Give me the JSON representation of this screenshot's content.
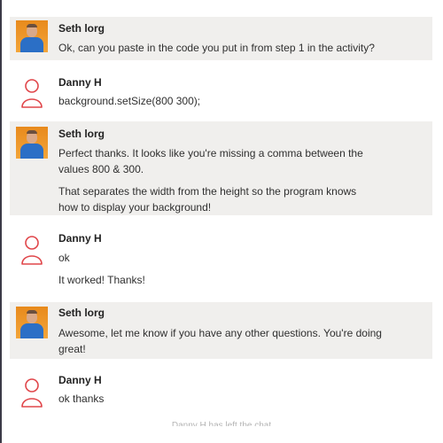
{
  "messages": [
    {
      "author": "Seth lorg",
      "avatar": "photo",
      "paragraphs": [
        "Ok, can you paste in the code you put in from step 1 in the activity?"
      ]
    },
    {
      "author": "Danny H",
      "avatar": "user-outline-icon",
      "paragraphs": [
        "background.setSize(800 300);"
      ]
    },
    {
      "author": "Seth lorg",
      "avatar": "photo",
      "paragraphs": [
        "Perfect thanks.  It looks like you're missing a comma between the values 800 & 300.",
        "That separates the width from the height so the program knows how to display your background!"
      ]
    },
    {
      "author": "Danny H",
      "avatar": "user-outline-icon",
      "paragraphs": [
        "ok",
        "It worked! Thanks!"
      ]
    },
    {
      "author": "Seth lorg",
      "avatar": "photo",
      "paragraphs": [
        "Awesome, let me know if you have any other questions. You're doing great!"
      ]
    },
    {
      "author": "Danny H",
      "avatar": "user-outline-icon",
      "paragraphs": [
        "ok thanks"
      ]
    }
  ],
  "footer": {
    "status": "Danny H has left the chat"
  },
  "colors": {
    "shaded_row": "#f0efed",
    "user_icon": "#e0464a",
    "left_rule": "#3b3a47"
  }
}
